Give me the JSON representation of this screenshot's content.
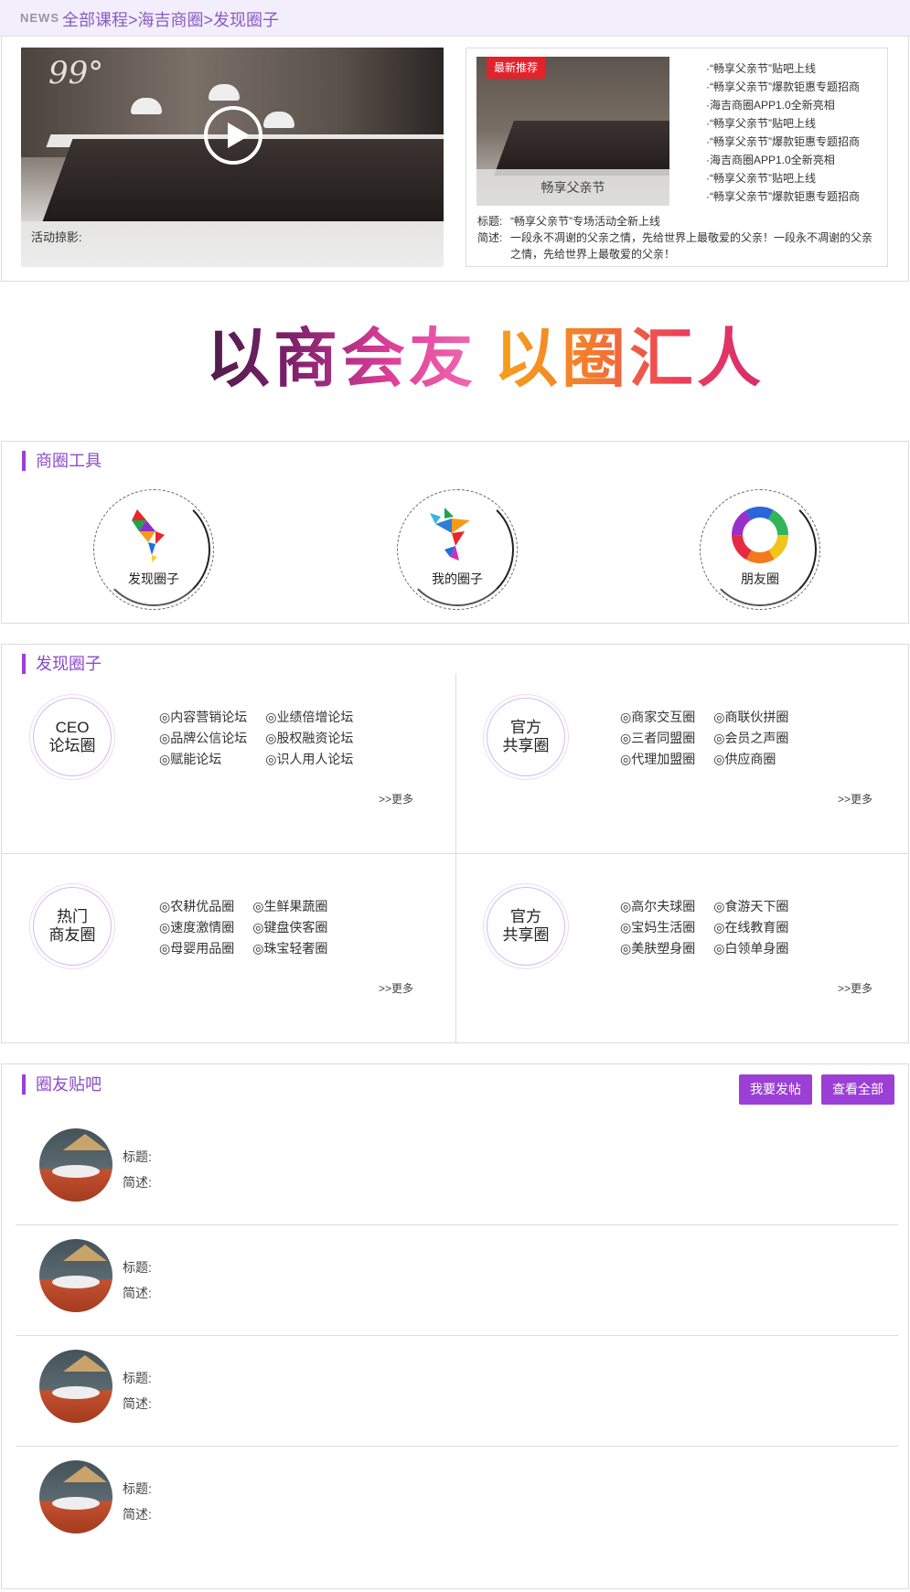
{
  "breadcrumb": {
    "news": "NEWS",
    "path": "全部课程>海吉商圈>发现圈子"
  },
  "video": {
    "caption": "活动掠影:",
    "logo": "99°"
  },
  "recommend": {
    "badge": "最新推荐",
    "image_caption": "畅享父亲节",
    "news": [
      "“畅享父亲节”贴吧上线",
      "“畅享父亲节”爆款钜惠专题招商",
      "海吉商圈APP1.0全新亮相",
      "“畅享父亲节”贴吧上线",
      "“畅享父亲节”爆款钜惠专题招商",
      "海吉商圈APP1.0全新亮相",
      "“畅享父亲节”贴吧上线",
      "“畅享父亲节”爆款钜惠专题招商"
    ],
    "title_label": "标题:",
    "title_value": "“畅享父亲节”专场活动全新上线",
    "desc_label": "简述:",
    "desc_value": "一段永不凋谢的父亲之情，先给世界上最敬爱的父亲！一段永不凋谢的父亲之情，先给世界上最敬爱的父亲！"
  },
  "slogan": {
    "left": "以商会友",
    "right": "以圈汇人"
  },
  "tools": {
    "title": "商圈工具",
    "items": [
      {
        "label": "发现圈子",
        "icon": "tangram-bird-icon"
      },
      {
        "label": "我的圈子",
        "icon": "tangram-person-icon"
      },
      {
        "label": "朋友圈",
        "icon": "color-ring-icon"
      }
    ]
  },
  "discover": {
    "title": "发现圈子",
    "more": ">>更多",
    "cells": [
      {
        "badge": [
          "CEO",
          "论坛圈"
        ],
        "items": [
          "内容营销论坛",
          "业绩倍增论坛",
          "品牌公信论坛",
          "股权融资论坛",
          "赋能论坛",
          "识人用人论坛"
        ]
      },
      {
        "badge": [
          "官方",
          "共享圈"
        ],
        "items": [
          "商家交互圈",
          "商联伙拼圈",
          "三者同盟圈",
          "会员之声圈",
          "代理加盟圈",
          "供应商圈"
        ]
      },
      {
        "badge": [
          "热门",
          "商友圈"
        ],
        "items": [
          "农耕优品圈",
          "生鲜果蔬圈",
          "速度激情圈",
          "键盘侠客圈",
          "母婴用品圈",
          "珠宝轻奢圈"
        ]
      },
      {
        "badge": [
          "官方",
          "共享圈"
        ],
        "items": [
          "高尔夫球圈",
          "食游天下圈",
          "宝妈生活圈",
          "在线教育圈",
          "美肤塑身圈",
          "白领单身圈"
        ]
      }
    ]
  },
  "forum": {
    "title": "圈友贴吧",
    "post_button": "我要发帖",
    "all_button": "查看全部",
    "posts": [
      {
        "title_label": "标题:",
        "desc_label": "简述:"
      },
      {
        "title_label": "标题:",
        "desc_label": "简述:"
      },
      {
        "title_label": "标题:",
        "desc_label": "简述:"
      },
      {
        "title_label": "标题:",
        "desc_label": "简述:"
      }
    ]
  },
  "colors": {
    "accent": "#9b3fd6",
    "badge_red": "#e3222c",
    "crumb_bg": "#f2eefb"
  }
}
